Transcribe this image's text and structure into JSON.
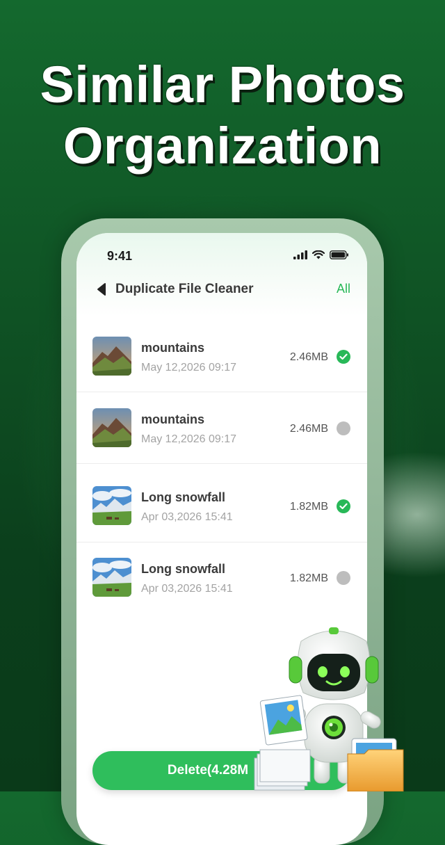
{
  "headline": {
    "line1": "Similar Photos",
    "line2": "Organization"
  },
  "status_bar": {
    "time": "9:41"
  },
  "nav": {
    "title": "Duplicate File Cleaner",
    "all_label": "All"
  },
  "files": [
    {
      "name": "mountains",
      "date": "May 12,2026 09:17",
      "size": "2.46MB",
      "selected": true,
      "thumb": "mountain-icon"
    },
    {
      "name": "mountains",
      "date": "May 12,2026 09:17",
      "size": "2.46MB",
      "selected": false,
      "thumb": "mountain-icon"
    },
    {
      "name": "Long snowfall",
      "date": "Apr 03,2026 15:41",
      "size": "1.82MB",
      "selected": true,
      "thumb": "snow-landscape-icon"
    },
    {
      "name": "Long snowfall",
      "date": "Apr 03,2026 15:41",
      "size": "1.82MB",
      "selected": false,
      "thumb": "snow-landscape-icon"
    }
  ],
  "delete_button": {
    "label": "Delete(4.28M"
  },
  "colors": {
    "accent": "#28b858",
    "background": "#0f5224"
  }
}
